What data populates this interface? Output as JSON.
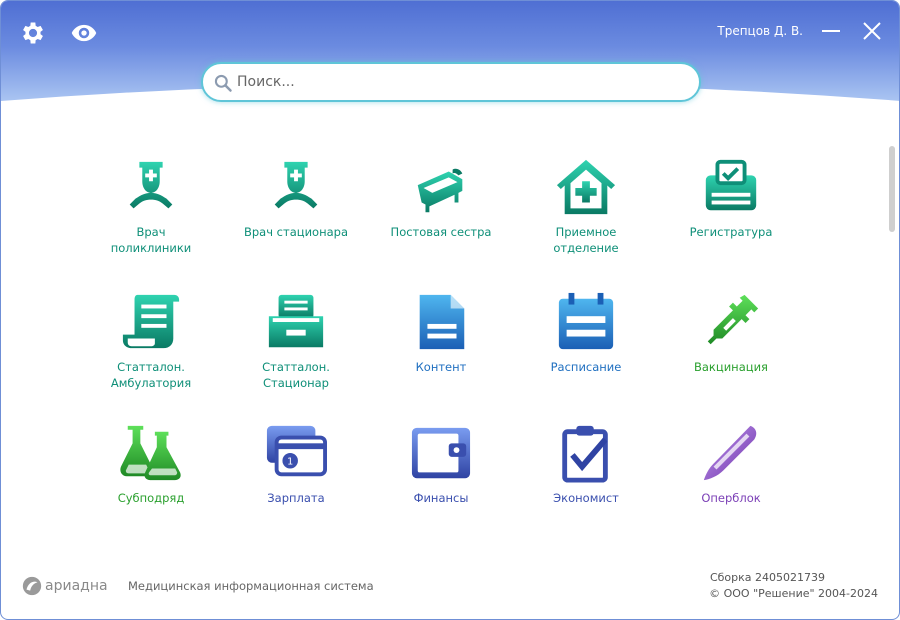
{
  "header": {
    "user_name": "Трепцов Д. В.",
    "colors": {
      "top": "#4f6fd3",
      "bottom": "#cfe0fa",
      "icons": "#ffffff"
    }
  },
  "search": {
    "placeholder": "Поиск..."
  },
  "tiles": [
    {
      "label": "Врач\nполиклиники",
      "icon": "doctor-icon",
      "color": "#0e8f78"
    },
    {
      "label": "Врач стационара",
      "icon": "doctor-icon",
      "color": "#0e8f78"
    },
    {
      "label": "Постовая сестра",
      "icon": "bed-icon",
      "color": "#0e8f78"
    },
    {
      "label": "Приемное\nотделение",
      "icon": "house-plus-icon",
      "color": "#0e8f78"
    },
    {
      "label": "Регистратура",
      "icon": "registry-icon",
      "color": "#0e8f78"
    },
    {
      "label": "Статталон.\nАмбулатория",
      "icon": "scroll-icon",
      "color": "#0e8f78"
    },
    {
      "label": "Статталон.\nСтационар",
      "icon": "drawer-icon",
      "color": "#0e8f78"
    },
    {
      "label": "Контент",
      "icon": "document-icon",
      "color": "#1f6fc0"
    },
    {
      "label": "Расписание",
      "icon": "calendar-icon",
      "color": "#1f6fc0"
    },
    {
      "label": "Вакцинация",
      "icon": "syringe-icon",
      "color": "#2aa02e"
    },
    {
      "label": "Субподряд",
      "icon": "flasks-icon",
      "color": "#2aa02e"
    },
    {
      "label": "Зарплата",
      "icon": "cards-icon",
      "color": "#3a4fae"
    },
    {
      "label": "Финансы",
      "icon": "wallet-icon",
      "color": "#3a4fae"
    },
    {
      "label": "Экономист",
      "icon": "checklist-icon",
      "color": "#3a4fae"
    },
    {
      "label": "Оперблок",
      "icon": "scalpel-icon",
      "color": "#7b3fb6"
    }
  ],
  "footer": {
    "logo_text": "ариадна",
    "description": "Медицинская информационная система",
    "build": "Сборка 2405021739",
    "copyright": "© ООО \"Решение\" 2004-2024"
  }
}
